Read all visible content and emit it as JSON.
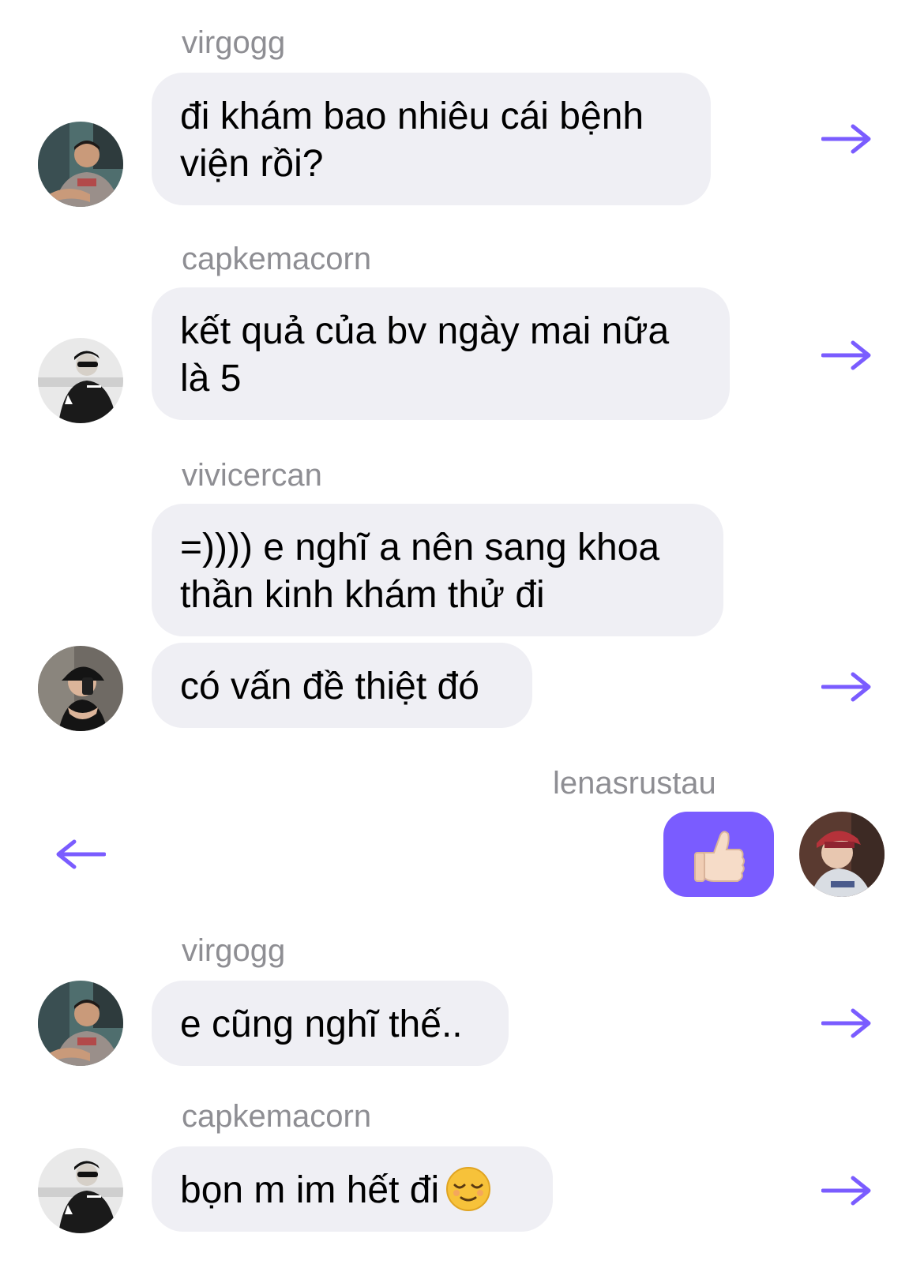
{
  "colors": {
    "accent": "#7a5cff",
    "bubble": "#efeff4",
    "sender_text": "#8e8e93"
  },
  "messages": [
    {
      "sender": "virgogg",
      "avatar_icon": "avatar-virgogg",
      "lines": [
        "đi khám bao nhiêu cái bệnh",
        "viện rồi?"
      ],
      "action_icon": "forward-arrow-icon"
    },
    {
      "sender": "capkemacorn",
      "avatar_icon": "avatar-capkemacorn",
      "lines": [
        "kết quả của bv ngày mai nữa",
        "là 5"
      ],
      "action_icon": "forward-arrow-icon"
    },
    {
      "sender": "vivicercan",
      "avatar_icon": "avatar-vivicercan",
      "lines": [
        "=)))) e nghĩ a nên sang khoa",
        "thần kinh khám thử đi"
      ],
      "action_icon": "none"
    },
    {
      "sender": "",
      "avatar_icon": "avatar-vivicercan",
      "lines": [
        "có vấn đề thiệt đó"
      ],
      "action_icon": "forward-arrow-icon"
    },
    {
      "sender": "lenasrustau",
      "avatar_icon": "avatar-lenasrustau",
      "lines": [],
      "reaction_icon": "thumbs-up-icon",
      "action_icon": "back-arrow-icon"
    },
    {
      "sender": "virgogg",
      "avatar_icon": "avatar-virgogg",
      "lines": [
        "e cũng nghĩ thế.."
      ],
      "action_icon": "forward-arrow-icon"
    },
    {
      "sender": "capkemacorn",
      "avatar_icon": "avatar-capkemacorn",
      "lines": [
        "bọn m im hết đi"
      ],
      "trailing_icon": "relieved-face-icon",
      "action_icon": "forward-arrow-icon"
    }
  ]
}
